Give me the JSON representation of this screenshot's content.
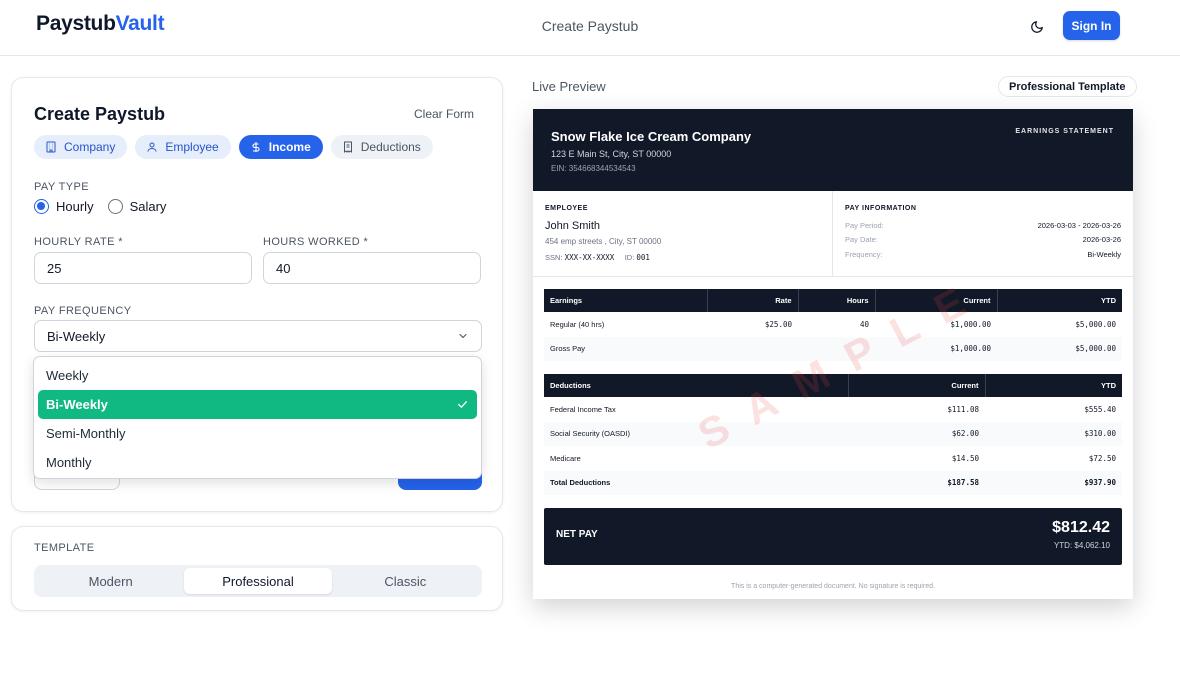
{
  "nav": {
    "logo_part1": "Paystub",
    "logo_part2": "Vault",
    "center_link": "Create Paystub",
    "theme_icon": "moon-icon",
    "sign_in": "Sign In"
  },
  "form": {
    "title": "Create Paystub",
    "clear": "Clear Form",
    "tabs": [
      {
        "label": "Company",
        "icon": "building-icon"
      },
      {
        "label": "Employee",
        "icon": "user-icon"
      },
      {
        "label": "Income",
        "icon": "dollar-icon"
      },
      {
        "label": "Deductions",
        "icon": "receipt-icon"
      }
    ],
    "active_tab": "Income",
    "pay_type_label": "PAY TYPE",
    "pay_type_options": [
      "Hourly",
      "Salary"
    ],
    "pay_type_selected": "Hourly",
    "hourly_rate_label": "HOURLY RATE *",
    "hourly_rate_value": "25",
    "hours_worked_label": "HOURS WORKED *",
    "hours_worked_value": "40",
    "pay_frequency_label": "PAY FREQUENCY",
    "pay_frequency_value": "Bi-Weekly",
    "frequency_options": [
      "Weekly",
      "Bi-Weekly",
      "Semi-Monthly",
      "Monthly"
    ]
  },
  "template": {
    "label": "TEMPLATE",
    "options": [
      "Modern",
      "Professional",
      "Classic"
    ],
    "selected": "Professional"
  },
  "preview": {
    "label": "Live Preview",
    "badge": "Professional Template",
    "company": {
      "name": "Snow Flake Ice Cream Company",
      "address": "123 E Main St, City, ST 00000",
      "ein": "EIN: 354668344534543"
    },
    "statement_title": "EARNINGS STATEMENT",
    "employee": {
      "heading": "EMPLOYEE",
      "name": "John Smith",
      "address": "454 emp streets , City, ST 00000",
      "ssn_label": "SSN:",
      "ssn": "XXX-XX-XXXX",
      "id_label": "ID:",
      "id": "001"
    },
    "pay_info": {
      "heading": "PAY INFORMATION",
      "rows": [
        {
          "label": "Pay Period:",
          "value": "2026-03-03 - 2026-03-26"
        },
        {
          "label": "Pay Date:",
          "value": "2026-03-26"
        },
        {
          "label": "Frequency:",
          "value": "Bi-Weekly"
        }
      ]
    },
    "earnings": {
      "headers": [
        "Earnings",
        "Rate",
        "Hours",
        "Current",
        "YTD"
      ],
      "rows": [
        {
          "name": "Regular (40 hrs)",
          "rate": "$25.00",
          "hours": "40",
          "current": "$1,000.00",
          "ytd": "$5,000.00"
        },
        {
          "name": "Gross Pay",
          "rate": "",
          "hours": "",
          "current": "$1,000.00",
          "ytd": "$5,000.00"
        }
      ]
    },
    "deductions": {
      "headers": [
        "Deductions",
        "Current",
        "YTD"
      ],
      "rows": [
        {
          "name": "Federal Income Tax",
          "current": "$111.08",
          "ytd": "$555.40"
        },
        {
          "name": "Social Security (OASDI)",
          "current": "$62.00",
          "ytd": "$310.00"
        },
        {
          "name": "Medicare",
          "current": "$14.50",
          "ytd": "$72.50"
        },
        {
          "name": "Total Deductions",
          "current": "$187.58",
          "ytd": "$937.90"
        }
      ]
    },
    "net_pay": {
      "label": "NET PAY",
      "amount": "$812.42",
      "ytd": "YTD: $4,062.10"
    },
    "footer": "This is a computer-generated document. No signature is required.",
    "watermark": "SAMPLE"
  },
  "colors": {
    "primary": "#2563eb",
    "success": "#10b981",
    "dark": "#111827"
  }
}
